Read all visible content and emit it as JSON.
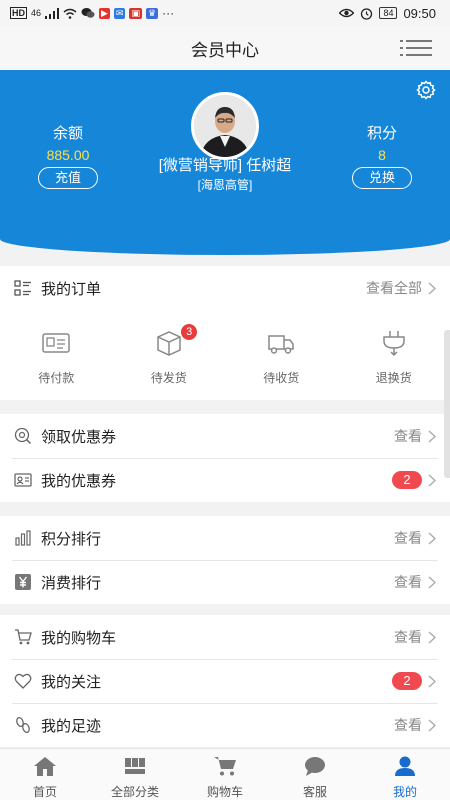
{
  "status_bar": {
    "left_chips": [
      "HD",
      "46"
    ],
    "battery": "84",
    "time": "09:50"
  },
  "header": {
    "title": "会员中心"
  },
  "profile": {
    "balance_label": "余额",
    "balance_value": "885.00",
    "recharge_button": "充值",
    "points_label": "积分",
    "points_value": "8",
    "exchange_button": "兑换",
    "name": "[微营销导师] 任树超",
    "subtitle": "[海恩高管]"
  },
  "orders": {
    "title": "我的订单",
    "view_all": "查看全部",
    "items": [
      {
        "label": "待付款",
        "icon": "wallet-icon"
      },
      {
        "label": "待发货",
        "icon": "box-icon",
        "badge": "3"
      },
      {
        "label": "待收货",
        "icon": "truck-icon"
      },
      {
        "label": "退换货",
        "icon": "plug-icon"
      }
    ]
  },
  "coupons": [
    {
      "label": "领取优惠券",
      "right": "查看",
      "icon": "coupon-search-icon"
    },
    {
      "label": "我的优惠券",
      "badge": "2",
      "icon": "coupon-card-icon"
    }
  ],
  "rankings": [
    {
      "label": "积分排行",
      "right": "查看",
      "icon": "bar-chart-icon"
    },
    {
      "label": "消费排行",
      "right": "查看",
      "icon": "yen-icon"
    }
  ],
  "personal": [
    {
      "label": "我的购物车",
      "right": "查看",
      "icon": "cart-icon"
    },
    {
      "label": "我的关注",
      "badge": "2",
      "icon": "heart-icon"
    },
    {
      "label": "我的足迹",
      "right": "查看",
      "icon": "footprint-icon"
    }
  ],
  "tabs": [
    {
      "label": "首页",
      "icon": "home-icon"
    },
    {
      "label": "全部分类",
      "icon": "category-icon"
    },
    {
      "label": "购物车",
      "icon": "cart-icon"
    },
    {
      "label": "客服",
      "icon": "chat-icon"
    },
    {
      "label": "我的",
      "icon": "user-icon",
      "active": true
    }
  ],
  "colors": {
    "brand_blue": "#1586d8",
    "balance_yellow": "#ffe14a",
    "badge_red": "#f0494f",
    "active_tab": "#1a6ccc"
  }
}
